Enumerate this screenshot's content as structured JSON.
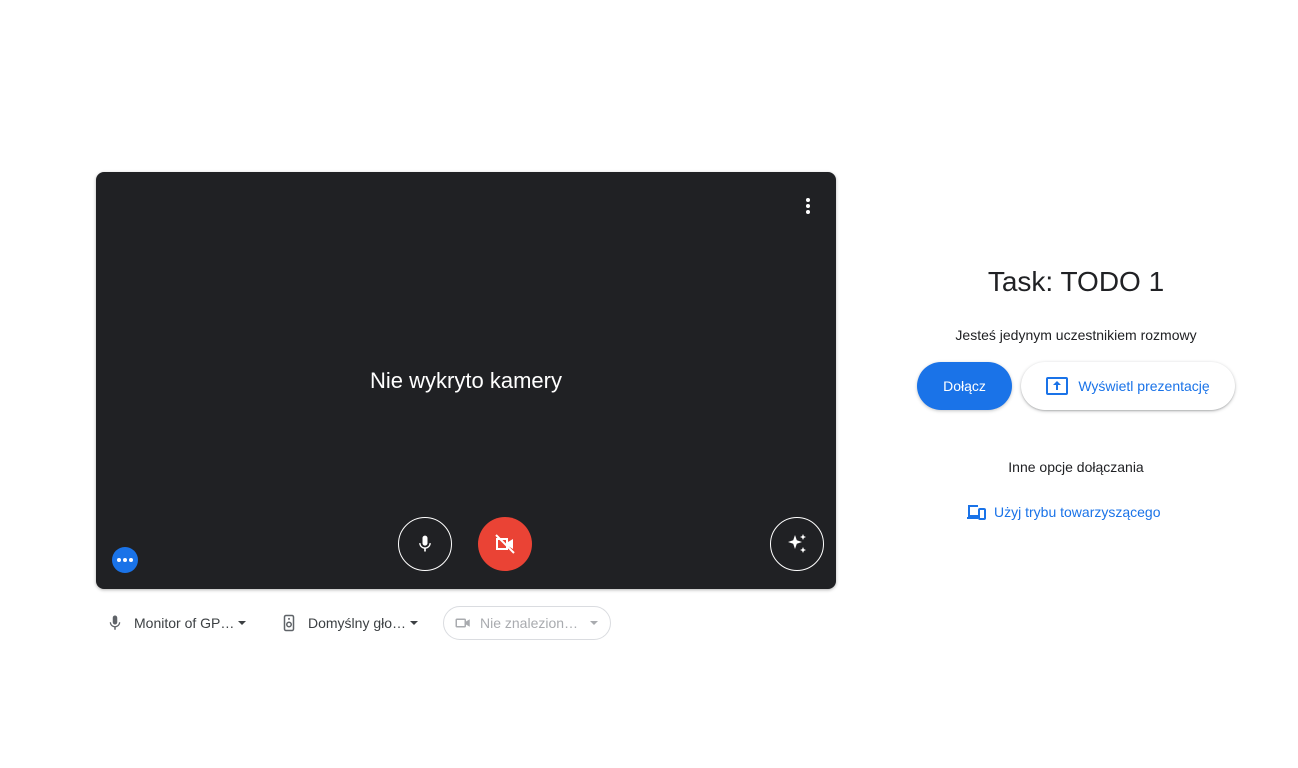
{
  "preview": {
    "no_camera_message": "Nie wykryto kamery",
    "options_icon": "more-vert-icon",
    "mic_icon": "mic-icon",
    "camera_icon": "videocam-off-icon",
    "effects_icon": "sparkle-icon",
    "more_icon": "more-horiz-icon",
    "camera_button_color": "#ea4335"
  },
  "devices": {
    "microphone": {
      "label": "Monitor of GP…",
      "icon": "mic-icon"
    },
    "speaker": {
      "label": "Domyślny gło…",
      "icon": "speaker-icon"
    },
    "camera": {
      "label": "Nie znalezion…",
      "icon": "videocam-icon"
    }
  },
  "panel": {
    "title": "Task: TODO 1",
    "participants": "Jesteś jedynym uczestnikiem rozmowy",
    "join_label": "Dołącz",
    "present_label": "Wyświetl prezentację",
    "present_icon": "present-to-all-icon",
    "other_options": "Inne opcje dołączania",
    "companion_label": "Użyj trybu towarzyszącego",
    "companion_icon": "devices-icon",
    "accent_color": "#1a73e8"
  }
}
